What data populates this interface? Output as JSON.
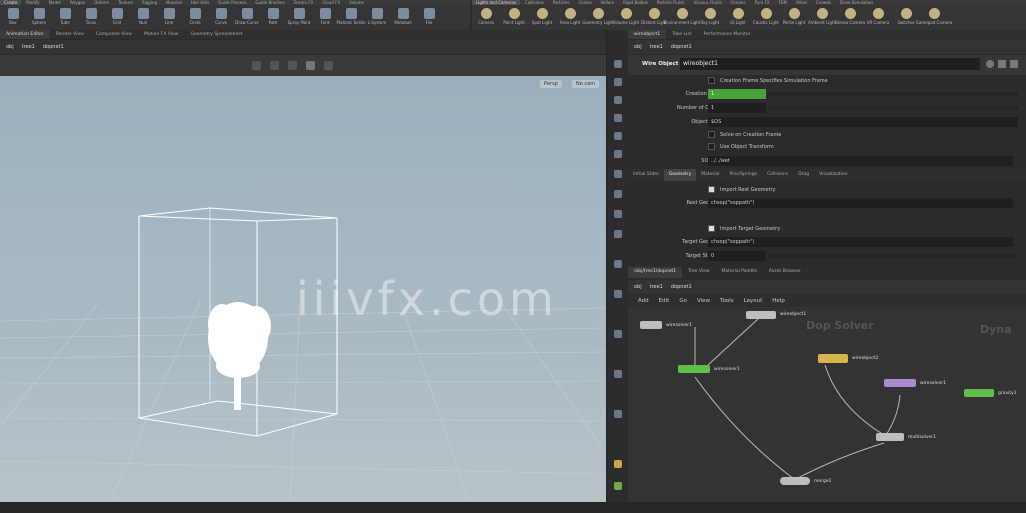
{
  "shelf": {
    "left_tabs": [
      "Create",
      "Modify",
      "Model",
      "Polygon",
      "Deform",
      "Texture",
      "Rigging",
      "Muscles",
      "Hair Utils",
      "Guide Process",
      "Guide Brushes",
      "Terrain FX",
      "Cloud FX",
      "Volume"
    ],
    "right_tabs": [
      "Lights and Cameras",
      "Collisions",
      "Particles",
      "Grains",
      "Vellum",
      "Rigid Bodies",
      "Particle Fluids",
      "Viscous Fluids",
      "Oceans",
      "Pyro FX",
      "FEM",
      "Wires",
      "Crowds",
      "Drive Simulation"
    ],
    "left_tools": [
      "Box",
      "Sphere",
      "Tube",
      "Torus",
      "Grid",
      "Null",
      "Line",
      "Circle",
      "Curve",
      "Draw Curve",
      "Path",
      "Spray Paint",
      "Font",
      "Platonic Solids",
      "L-System",
      "Metaball",
      "File"
    ],
    "right_tools": [
      "Camera",
      "Point Light",
      "Spot Light",
      "Area Light",
      "Geometry Light",
      "Volume Light",
      "Distant Light",
      "Environment Light",
      "Sky Light",
      "GI Light",
      "Caustic Light",
      "Portal Light",
      "Ambient Light",
      "Stereo Camera",
      "VR Camera",
      "Switcher",
      "Gamepad Camera"
    ]
  },
  "left_pane": {
    "tabs": [
      "Animation Editor",
      "Render View",
      "Composite View",
      "Motion FX View",
      "Geometry Spreadsheet"
    ],
    "path": [
      "obj",
      "tree1",
      "dopnet1"
    ],
    "view_menu": "Persp",
    "cam_menu": "No cam"
  },
  "right_pane": {
    "tabs": [
      "wireobject1",
      "Take List",
      "Performance Monitor"
    ],
    "path": [
      "obj",
      "tree1",
      "dopnet1"
    ]
  },
  "params": {
    "node_type": "Wire Object",
    "node_name": "wireobject1",
    "creation_frame_label": "Creation Frame Specifies Simulation Frame",
    "creation_frame": "1",
    "creation_frame_field_label": "Creation Frame",
    "num_objects_label": "Number of Objects",
    "num_objects": "1",
    "object_name_label": "Object Name",
    "object_name": "$OS",
    "solve_label": "Solve on Creation Frame",
    "use_transform_label": "Use Object Transform",
    "sop_path_label": "SOP Path",
    "sop_path": "../../wet",
    "section_tabs": [
      "Initial State",
      "Geometry",
      "Material",
      "Pins/Springs",
      "Collisions",
      "Drag",
      "Visualization"
    ],
    "active_tab": "Geometry",
    "import_rest_label": "Import Rest Geometry",
    "rest_geometry_label": "Rest Geometry",
    "rest_geometry": "chsop(\"soppath\")",
    "import_target_label": "Import Target Geometry",
    "target_geometry_label": "Target Geometry",
    "target_geometry": "chsop(\"soppath\")",
    "target_stiffness_label": "Target Stiffness",
    "target_stiffness": "0"
  },
  "network": {
    "tabs": [
      "/obj/tree1/dopnet1",
      "Tree View",
      "Material Palette",
      "Asset Browser"
    ],
    "path": [
      "obj",
      "tree1",
      "dopnet1"
    ],
    "menu": [
      "Add",
      "Edit",
      "Go",
      "View",
      "Tools",
      "Layout",
      "Help"
    ],
    "bg_labels": [
      "Dop Solver",
      "Dyna"
    ],
    "nodes": [
      "wiresolver1",
      "wireobject1",
      "wiresolver1",
      "wireobject2",
      "wiresolver1",
      "gravity1",
      "multisolver1",
      "merge1",
      "sopobject1"
    ]
  },
  "watermark": "iiivfx.com",
  "colors": {
    "node_green": "#5fbf4a",
    "node_purple": "#a98bd0",
    "node_yellow": "#d8b54a",
    "node_gray": "#bdbdbd",
    "slider_green": "#4aa13a"
  }
}
